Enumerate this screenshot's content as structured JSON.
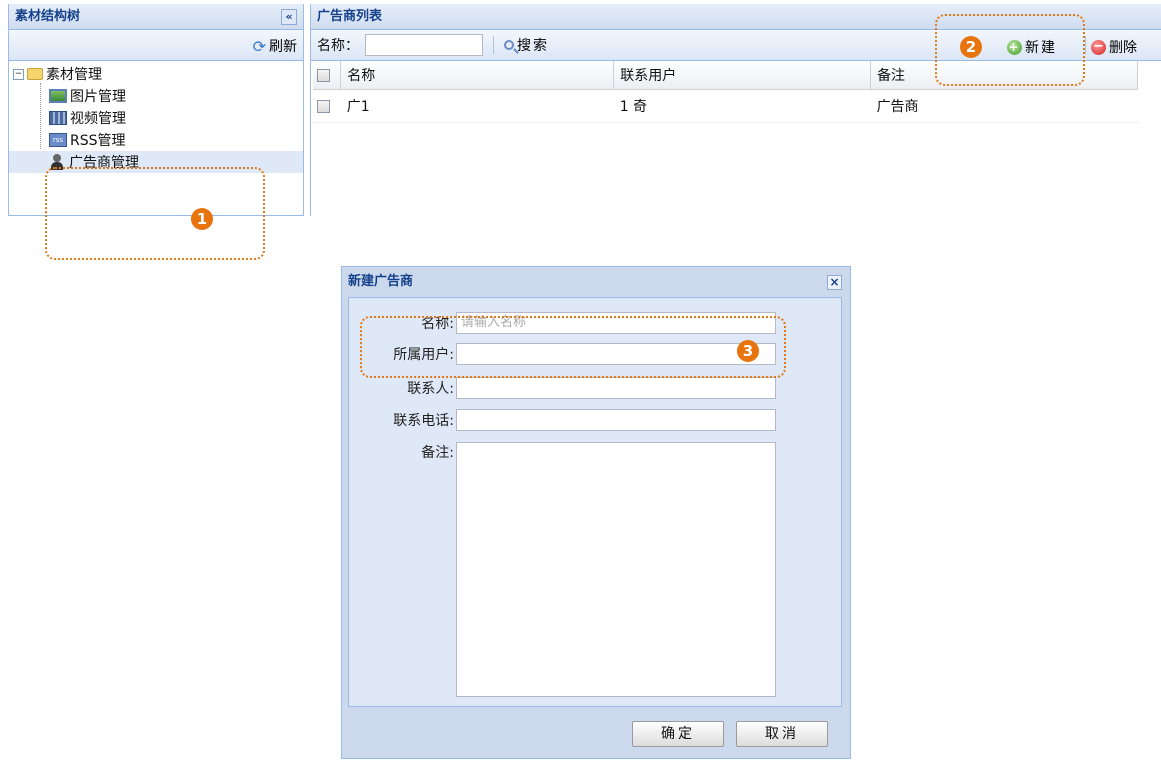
{
  "left_panel": {
    "title": "素材结构树",
    "collapse_glyph": "«",
    "refresh_label": "刷新",
    "tree": {
      "root_label": "素材管理",
      "root_toggle": "−",
      "items": [
        {
          "label": "图片管理",
          "icon": "image-icon"
        },
        {
          "label": "视频管理",
          "icon": "video-icon"
        },
        {
          "label": "RSS管理",
          "icon": "rss-icon"
        },
        {
          "label": "广告商管理",
          "icon": "person-icon"
        }
      ]
    }
  },
  "right_panel": {
    "title": "广告商列表",
    "search": {
      "label": "名称：",
      "value": "",
      "button_label": "搜索"
    },
    "actions": {
      "new_label": "新建",
      "delete_label": "删除"
    },
    "table": {
      "columns": [
        "名称",
        "联系用户",
        "备注"
      ],
      "rows": [
        {
          "name": "广1",
          "user": "1  奇",
          "note": "广告商"
        }
      ]
    }
  },
  "dialog": {
    "title": "新建广告商",
    "close_glyph": "×",
    "fields": {
      "name_label": "名称:",
      "name_placeholder": "请输入名称",
      "owner_label": "所属用户:",
      "contact_label": "联系人:",
      "phone_label": "联系电话:",
      "note_label": "备注:"
    },
    "ok_label": "确定",
    "cancel_label": "取消"
  },
  "callouts": {
    "one": "1",
    "two": "2",
    "three": "3"
  },
  "colors": {
    "accent": "#e8740e",
    "header_text": "#15428b",
    "border": "#99bbe8",
    "panel_bg": "#dfe8f6"
  }
}
